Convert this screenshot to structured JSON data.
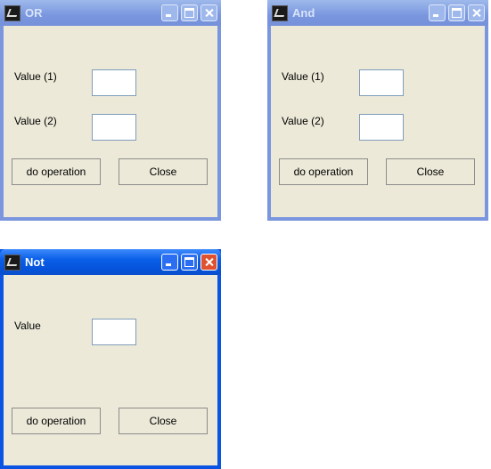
{
  "windows": {
    "or": {
      "title": "OR",
      "state": "inactive",
      "label1": "Value (1)",
      "label2": "Value (2)",
      "value1": "",
      "value2": "",
      "operation_button": "do operation",
      "close_button": "Close"
    },
    "and": {
      "title": "And",
      "state": "inactive",
      "label1": "Value (1)",
      "label2": "Value (2)",
      "value1": "",
      "value2": "",
      "operation_button": "do operation",
      "close_button": "Close"
    },
    "not": {
      "title": "Not",
      "state": "active",
      "label": "Value",
      "value": "",
      "operation_button": "do operation",
      "close_button": "Close"
    }
  },
  "icons": {
    "app": "java-app-icon",
    "minimize": "minimize-icon",
    "maximize": "maximize-icon",
    "close": "close-icon"
  },
  "colors": {
    "client_bg": "#ece9d8",
    "active_title": "#0a54e3",
    "inactive_title": "#7a96df"
  }
}
